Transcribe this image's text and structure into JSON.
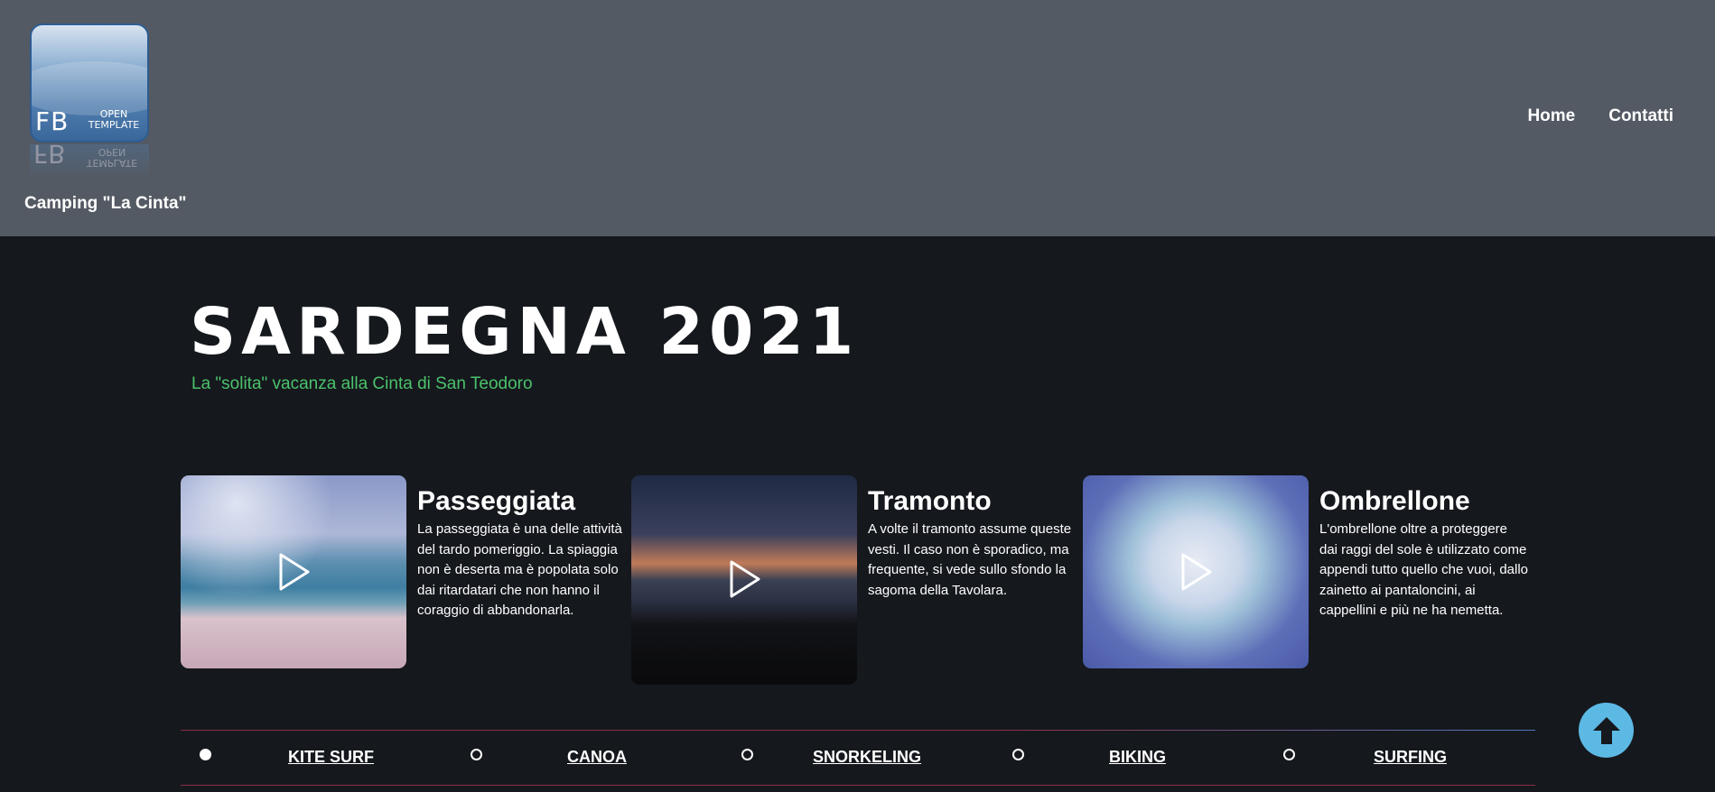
{
  "header": {
    "logo": {
      "main_text": "FB",
      "sub_text_1": "OPEN",
      "sub_text_2": "TEMPLATE"
    },
    "site_name": "Camping \"La Cinta\"",
    "nav": [
      {
        "label": "Home"
      },
      {
        "label": "Contatti"
      }
    ]
  },
  "hero": {
    "title": "SARDEGNA 2021",
    "subtitle": "La \"solita\" vacanza alla Cinta di San Teodoro",
    "subtitle_color": "#4bc26b"
  },
  "cards": [
    {
      "title": "Passeggiata",
      "text": "La passeggiata è una delle attività del tardo pomeriggio. La spiaggia non è deserta ma è popolata solo dai ritardatari che non hanno il coraggio di abbandonarla.",
      "icon": "play-icon"
    },
    {
      "title": "Tramonto",
      "text": "A volte il tramonto assume queste vesti. Il caso non è sporadico, ma frequente, si vede sullo sfondo la sagoma della Tavolara.",
      "icon": "play-icon"
    },
    {
      "title": "Ombrellone",
      "text": "L'ombrellone oltre a proteggere dai raggi del sole è utilizzato come appendi tutto quello che vuoi, dallo zainetto ai pantaloncini, ai cappellini e più ne ha nemetta.",
      "icon": "play-icon"
    }
  ],
  "tabs": [
    {
      "label": "KITE SURF",
      "active": true
    },
    {
      "label": "CANOA",
      "active": false
    },
    {
      "label": "SNORKELING",
      "active": false
    },
    {
      "label": "BIKING",
      "active": false
    },
    {
      "label": "SURFING",
      "active": false
    }
  ],
  "scroll_top": {
    "icon": "arrow-up-icon",
    "color": "#5cb9e4"
  }
}
